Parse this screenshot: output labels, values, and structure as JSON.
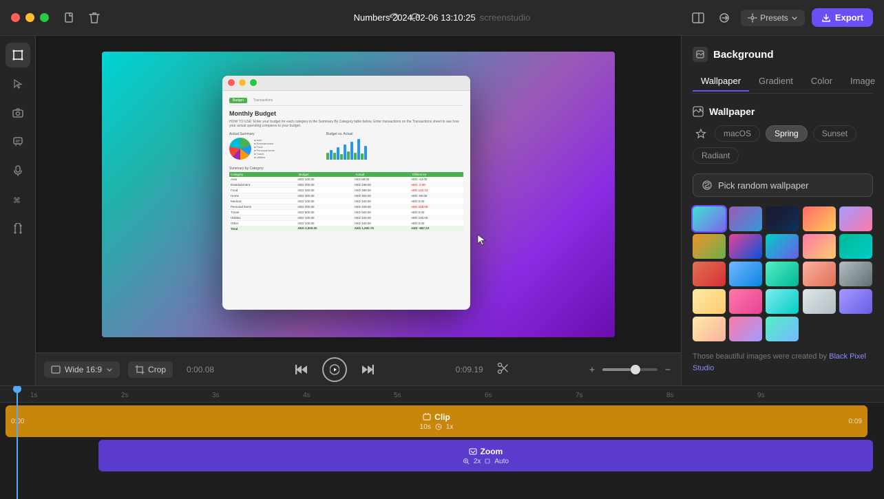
{
  "titlebar": {
    "title": "Numbers 2024-02-06 13:10:25",
    "subtitle": "screenstudio",
    "undo_label": "↩",
    "redo_label": "↪",
    "presets_label": "Presets",
    "export_label": "Export",
    "file_icon": "📁",
    "trash_icon": "🗑"
  },
  "toolbar": {
    "aspect_label": "Wide 16:9",
    "crop_label": "Crop",
    "time_start": "0:00.08",
    "time_end": "0:09.19",
    "play_icon": "▶"
  },
  "left_tools": {
    "items": [
      {
        "name": "select-tool",
        "icon": "⬜",
        "active": true
      },
      {
        "name": "cursor-tool",
        "icon": "↖"
      },
      {
        "name": "camera-tool",
        "icon": "📷"
      },
      {
        "name": "speech-tool",
        "icon": "💬"
      },
      {
        "name": "audio-tool",
        "icon": "🔊"
      },
      {
        "name": "shortcut-tool",
        "icon": "⌘"
      },
      {
        "name": "cursor2-tool",
        "icon": "⚓"
      }
    ]
  },
  "right_panel": {
    "background_label": "Background",
    "tabs": [
      {
        "label": "Wallpaper",
        "active": true
      },
      {
        "label": "Gradient"
      },
      {
        "label": "Color"
      },
      {
        "label": "Image"
      }
    ],
    "wallpaper_section": "Wallpaper",
    "filters": [
      "macOS",
      "Spring",
      "Sunset",
      "Radiant"
    ],
    "active_filter": "Spring",
    "random_label": "Pick random wallpaper",
    "credit_text": "Those beautiful images were created by",
    "credit_link": "Black Pixel Studio"
  },
  "timeline": {
    "clip_label": "Clip",
    "clip_duration": "10s",
    "clip_speed": "1x",
    "clip_time_start": "0:00",
    "clip_time_end": "0:09",
    "zoom_label": "Zoom",
    "zoom_scale": "2x",
    "zoom_mode": "Auto",
    "ruler_marks": [
      "1s",
      "2s",
      "3s",
      "4s",
      "5s",
      "6s",
      "7s",
      "8s",
      "9s"
    ]
  },
  "mac_window": {
    "title": "Monthly Budget"
  }
}
